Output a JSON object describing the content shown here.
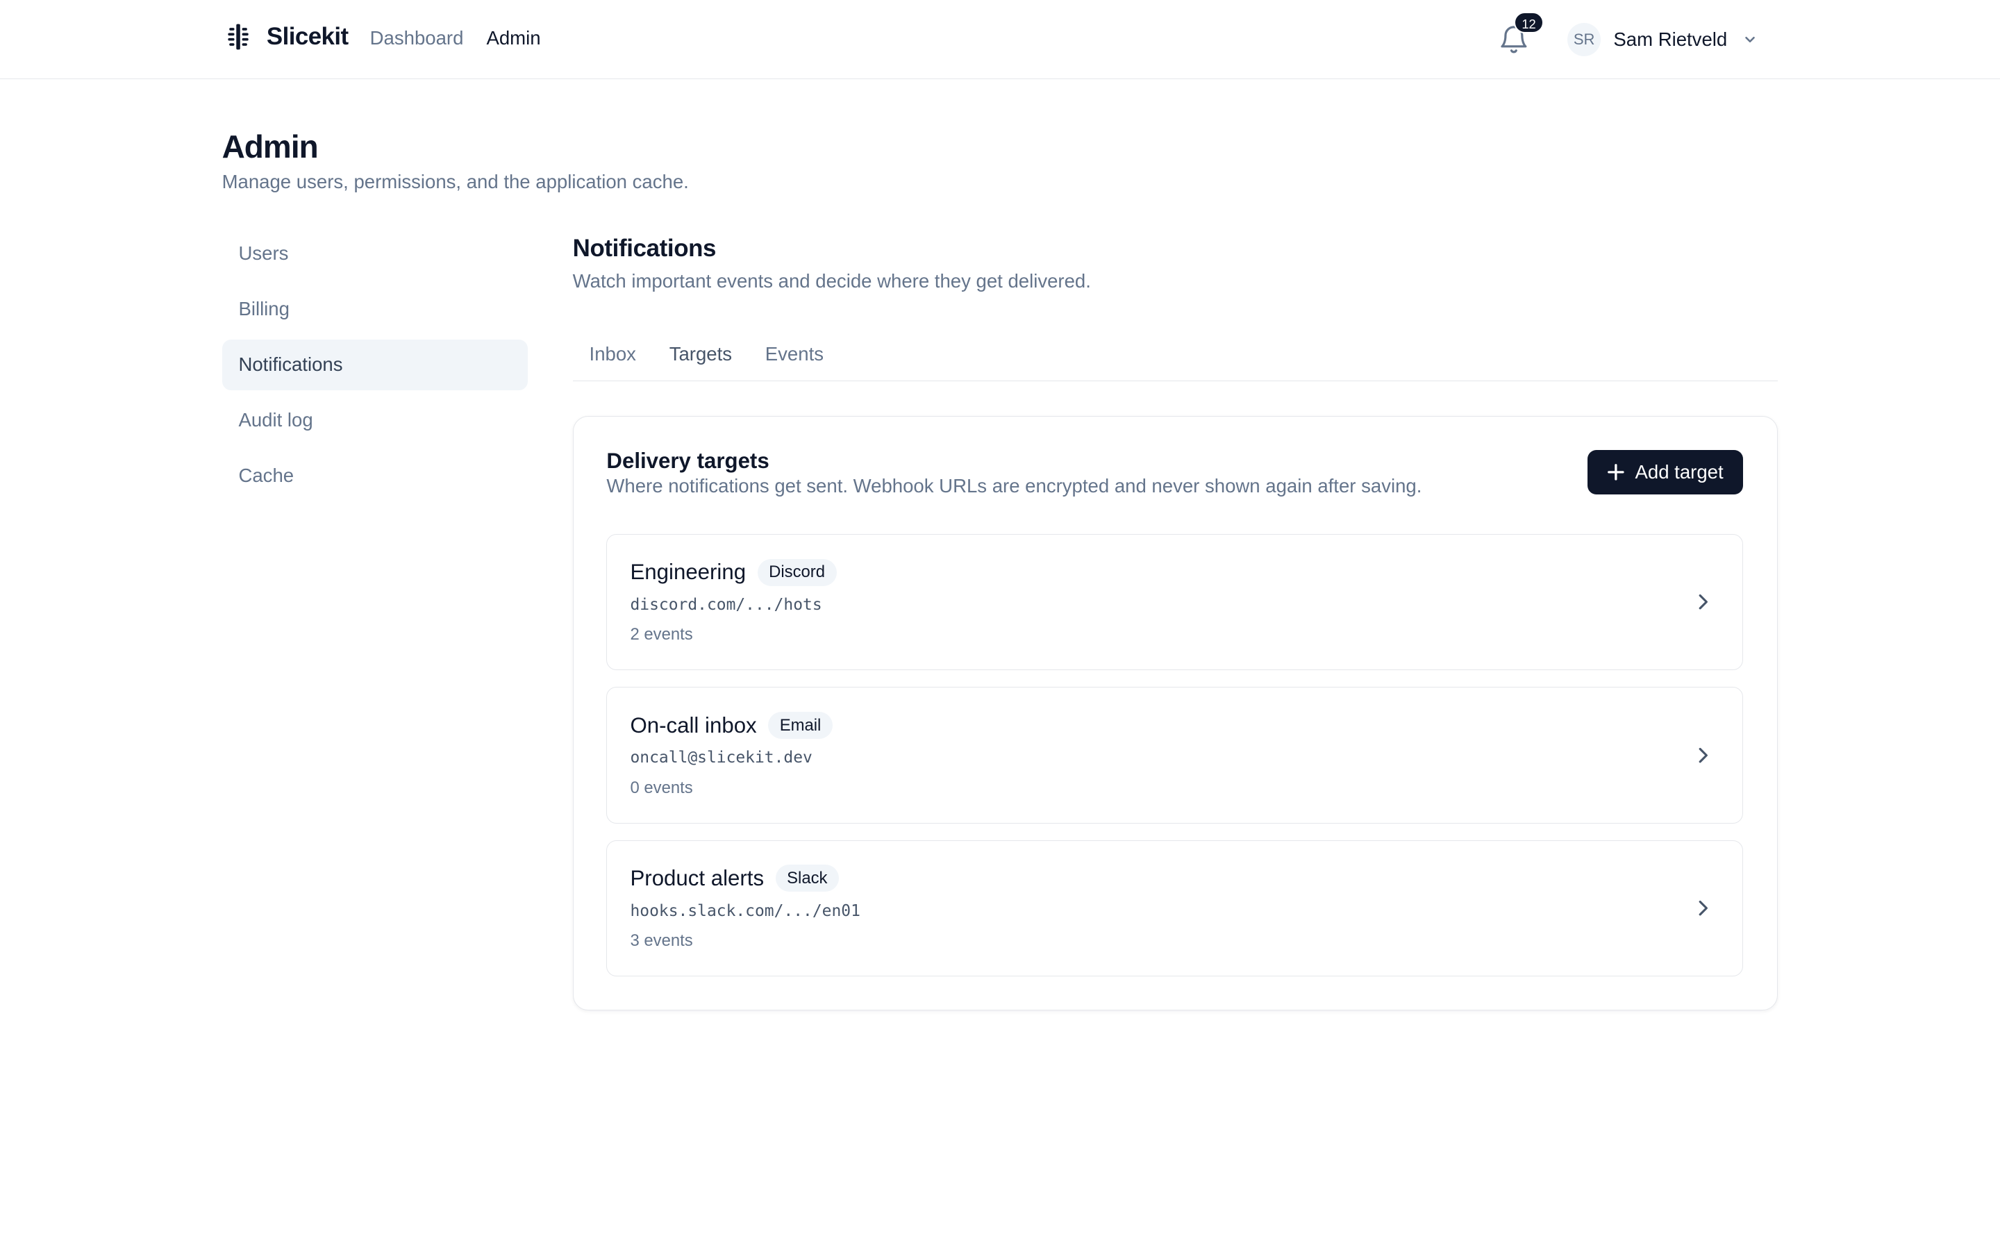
{
  "header": {
    "brand": "Slicekit",
    "nav": [
      {
        "label": "Dashboard",
        "active": false
      },
      {
        "label": "Admin",
        "active": true
      }
    ],
    "notification_count": "12",
    "user_initials": "SR",
    "user_name": "Sam Rietveld"
  },
  "page": {
    "title": "Admin",
    "subtitle": "Manage users, permissions, and the application cache."
  },
  "sidebar": {
    "items": [
      {
        "label": "Users",
        "active": false
      },
      {
        "label": "Billing",
        "active": false
      },
      {
        "label": "Notifications",
        "active": true
      },
      {
        "label": "Audit log",
        "active": false
      },
      {
        "label": "Cache",
        "active": false
      }
    ]
  },
  "section": {
    "title": "Notifications",
    "subtitle": "Watch important events and decide where they get delivered.",
    "tabs": [
      {
        "label": "Inbox",
        "active": false
      },
      {
        "label": "Targets",
        "active": true
      },
      {
        "label": "Events",
        "active": false
      }
    ]
  },
  "card": {
    "title": "Delivery targets",
    "subtitle": "Where notifications get sent. Webhook URLs are encrypted and never shown again after saving.",
    "add_label": "Add target",
    "targets": [
      {
        "name": "Engineering",
        "type": "Discord",
        "url": "discord.com/.../hots",
        "events": "2 events"
      },
      {
        "name": "On-call inbox",
        "type": "Email",
        "url": "oncall@slicekit.dev",
        "events": "0 events"
      },
      {
        "name": "Product alerts",
        "type": "Slack",
        "url": "hooks.slack.com/.../en01",
        "events": "3 events"
      }
    ]
  },
  "colors": {
    "primary": "#0f172a",
    "muted_text": "#64748b",
    "active_bg": "#f1f5f9",
    "border": "#e5e7eb"
  }
}
